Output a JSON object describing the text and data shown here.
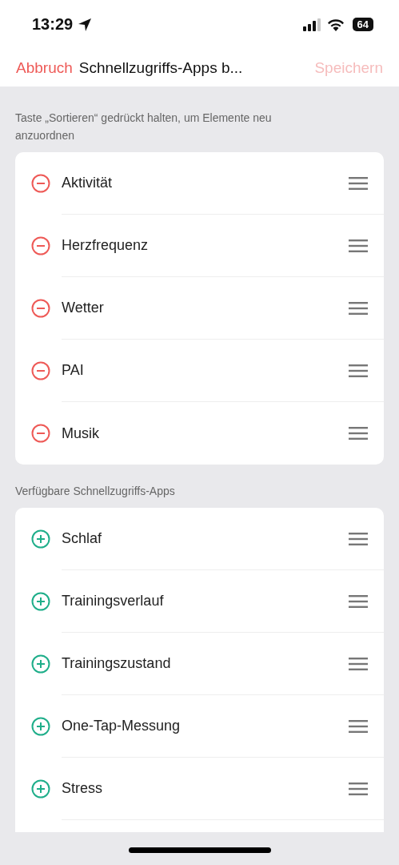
{
  "status_bar": {
    "time": "13:29",
    "battery": "64"
  },
  "nav": {
    "cancel": "Abbruch",
    "title": "Schnellzugriffs-Apps b...",
    "save": {
      "label": "Speichern",
      "disabled": true
    }
  },
  "sections": [
    {
      "caption": "Taste „Sortieren“ gedrückt halten, um Elemente neu anzuordnen",
      "kind": "active",
      "items": [
        "Aktivität",
        "Herzfrequenz",
        "Wetter",
        "PAI",
        "Musik"
      ],
      "continues": false
    },
    {
      "caption": "Verfügbare Schnellzugriffs-Apps",
      "kind": "available",
      "items": [
        "Schlaf",
        "Trainingsverlauf",
        "Trainingszustand",
        "One-Tap-Messung",
        "Stress"
      ],
      "continues": true
    }
  ]
}
